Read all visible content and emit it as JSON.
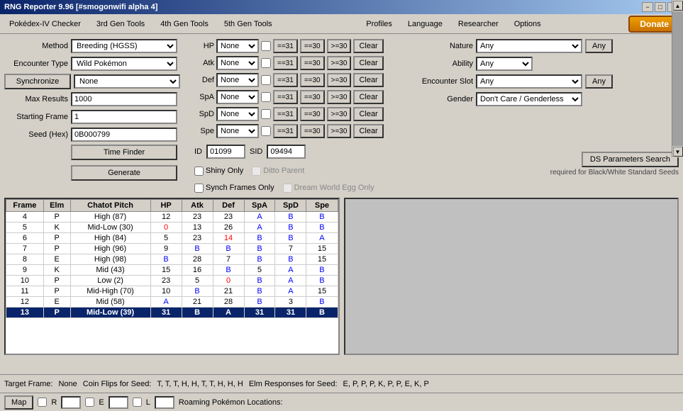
{
  "window": {
    "title": "RNG Reporter 9.96 [#smogonwifi alpha 4]",
    "close": "×",
    "minimize": "−",
    "maximize": "□"
  },
  "menu": {
    "items": [
      "Pokédex-IV Checker",
      "3rd Gen Tools",
      "4th Gen Tools",
      "5th Gen Tools",
      "Profiles",
      "Language",
      "Researcher",
      "Options"
    ],
    "donate": "Donate"
  },
  "left": {
    "method_label": "Method",
    "method_value": "Breeding (HGSS)",
    "encounter_label": "Encounter Type",
    "encounter_value": "Wild Pokémon",
    "synchronize_label": "Synchronize",
    "synchronize_value": "None",
    "max_results_label": "Max Results",
    "max_results_value": "1000",
    "starting_frame_label": "Starting Frame",
    "starting_frame_value": "1",
    "seed_label": "Seed (Hex)",
    "seed_value": "0B000799",
    "time_finder_btn": "Time Finder",
    "generate_btn": "Generate"
  },
  "stats": {
    "rows": [
      {
        "label": "HP",
        "select": "None",
        "eq31": "==31",
        "eq30": "==30",
        "ge30": ">=30",
        "clear": "Clear"
      },
      {
        "label": "Atk",
        "select": "None",
        "eq31": "==31",
        "eq30": "==30",
        "ge30": ">=30",
        "clear": "Clear"
      },
      {
        "label": "Def",
        "select": "None",
        "eq31": "==31",
        "eq30": "==30",
        "ge30": ">=30",
        "clear": "Clear"
      },
      {
        "label": "SpA",
        "select": "None",
        "eq31": "==31",
        "eq30": "==30",
        "ge30": ">=30",
        "clear": "Clear"
      },
      {
        "label": "SpD",
        "select": "None",
        "eq31": "==31",
        "eq30": "==30",
        "ge30": ">=30",
        "clear": "Clear"
      },
      {
        "label": "Spe",
        "select": "None",
        "eq31": "==31",
        "eq30": "==30",
        "ge30": ">=30",
        "clear": "Clear"
      }
    ]
  },
  "right": {
    "nature_label": "Nature",
    "nature_value": "Any",
    "any1_btn": "Any",
    "ability_label": "Ability",
    "ability_value": "Any",
    "encounter_slot_label": "Encounter Slot",
    "encounter_slot_value": "Any",
    "any2_btn": "Any",
    "gender_label": "Gender",
    "gender_value": "Don't Care / Genderless"
  },
  "id_section": {
    "id_label": "ID",
    "id_value": "01099",
    "sid_label": "SID",
    "sid_value": "09494",
    "shiny_only": "Shiny Only",
    "ditto_parent": "Ditto Parent",
    "synch_frames": "Synch Frames Only",
    "dream_world": "Dream World Egg Only",
    "ds_params_btn": "DS Parameters Search",
    "ds_info": "required for Black/White Standard Seeds"
  },
  "table": {
    "headers": [
      "Frame",
      "Elm",
      "Chatot Pitch",
      "HP",
      "Atk",
      "Def",
      "SpA",
      "SpD",
      "Spe"
    ],
    "rows": [
      {
        "frame": "4",
        "elm": "P",
        "chatot": "High (87)",
        "hp": "12",
        "atk": "23",
        "def": "23",
        "spa": "A",
        "spd": "B",
        "spe": "B",
        "atk_color": "normal",
        "hp_color": "normal",
        "def_color": "normal",
        "spa_color": "blue",
        "spd_color": "blue",
        "spe_color": "blue"
      },
      {
        "frame": "5",
        "elm": "K",
        "chatot": "Mid-Low (30)",
        "hp": "0",
        "atk": "13",
        "def": "26",
        "spa": "A",
        "spd": "B",
        "spe": "B",
        "hp_color": "red",
        "atk_color": "normal",
        "def_color": "normal",
        "spa_color": "blue",
        "spd_color": "blue",
        "spe_color": "blue"
      },
      {
        "frame": "6",
        "elm": "P",
        "chatot": "High (84)",
        "hp": "5",
        "atk": "23",
        "def": "14",
        "spa": "B",
        "spd": "B",
        "spe": "A",
        "hp_color": "normal",
        "atk_color": "normal",
        "def_color": "red",
        "spa_color": "blue",
        "spd_color": "blue",
        "spe_color": "blue"
      },
      {
        "frame": "7",
        "elm": "P",
        "chatot": "High (96)",
        "hp": "9",
        "atk": "B",
        "def": "B",
        "spa": "B",
        "spd": "7",
        "spe": "15",
        "hp_color": "normal",
        "atk_color": "blue",
        "def_color": "blue",
        "spa_color": "blue",
        "spd_color": "normal",
        "spe_color": "normal"
      },
      {
        "frame": "8",
        "elm": "E",
        "chatot": "High (98)",
        "hp": "B",
        "atk": "28",
        "def": "7",
        "spa": "B",
        "spd": "B",
        "spe": "15",
        "hp_color": "blue",
        "atk_color": "normal",
        "def_color": "normal",
        "spa_color": "blue",
        "spd_color": "blue",
        "spe_color": "normal"
      },
      {
        "frame": "9",
        "elm": "K",
        "chatot": "Mid (43)",
        "hp": "15",
        "atk": "16",
        "def": "B",
        "spa": "5",
        "spd": "A",
        "spe": "B",
        "hp_color": "normal",
        "atk_color": "normal",
        "def_color": "blue",
        "spa_color": "normal",
        "spd_color": "blue",
        "spe_color": "blue"
      },
      {
        "frame": "10",
        "elm": "P",
        "chatot": "Low (2)",
        "hp": "23",
        "atk": "5",
        "def": "0",
        "spa": "B",
        "spd": "A",
        "spe": "B",
        "hp_color": "normal",
        "atk_color": "normal",
        "def_color": "red",
        "spa_color": "blue",
        "spd_color": "blue",
        "spe_color": "blue"
      },
      {
        "frame": "11",
        "elm": "P",
        "chatot": "Mid-High (70)",
        "hp": "10",
        "atk": "B",
        "def": "21",
        "spa": "B",
        "spd": "A",
        "spe": "15",
        "hp_color": "normal",
        "atk_color": "blue",
        "def_color": "normal",
        "spa_color": "blue",
        "spd_color": "blue",
        "spe_color": "normal"
      },
      {
        "frame": "12",
        "elm": "E",
        "chatot": "Mid (58)",
        "hp": "A",
        "atk": "21",
        "def": "28",
        "spa": "B",
        "spd": "3",
        "spe": "B",
        "hp_color": "blue",
        "atk_color": "normal",
        "def_color": "normal",
        "spa_color": "blue",
        "spd_color": "normal",
        "spe_color": "blue"
      },
      {
        "frame": "13",
        "elm": "P",
        "chatot": "Mid-Low (39)",
        "hp": "31",
        "atk": "B",
        "def": "A",
        "spa": "31",
        "spd": "31",
        "spe": "B",
        "highlight": true,
        "hp_color": "normal",
        "atk_color": "blue",
        "def_color": "blue",
        "spa_color": "normal",
        "spd_color": "normal",
        "spe_color": "blue"
      }
    ]
  },
  "bottom": {
    "target_frame_label": "Target Frame:",
    "target_frame_value": "None",
    "coin_flips_label": "Coin Flips for Seed:",
    "coin_flips_value": "T, T, T, H, H, T, T, H, H, H",
    "elm_label": "Elm Responses for Seed:",
    "elm_value": "E, P, P, P, K, P, P, E, K, P",
    "map_btn": "Map",
    "r_label": "R",
    "e_label": "E",
    "l_label": "L",
    "roaming_label": "Roaming Pokémon Locations:"
  }
}
